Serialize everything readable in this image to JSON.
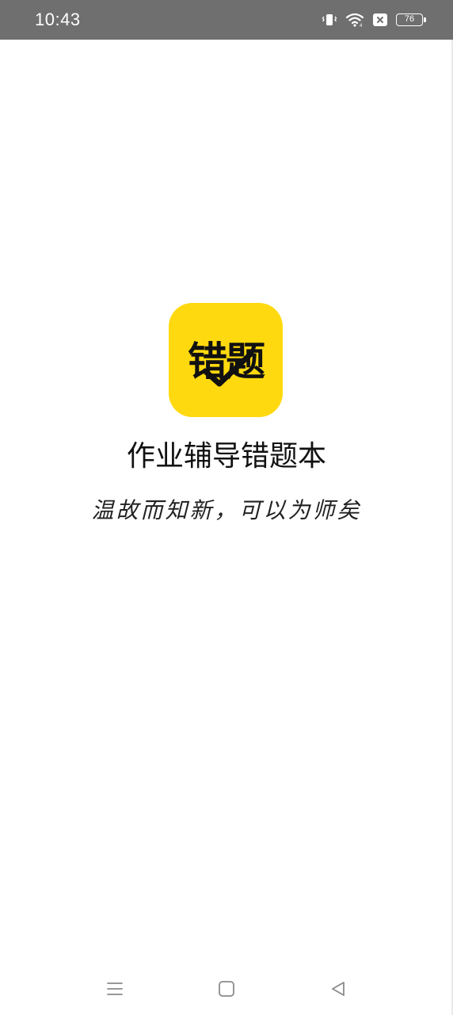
{
  "status_bar": {
    "time": "10:43",
    "battery_level": "76",
    "icons": [
      "vibrate-icon",
      "wifi-icon",
      "sim-off-icon",
      "battery-icon"
    ]
  },
  "splash": {
    "logo_text": "错题",
    "app_name": "作业辅导错题本",
    "slogan": "温故而知新，可以为师矣",
    "brand_color": "#ffd90f"
  },
  "nav_bar": {
    "icons": [
      "menu-icon",
      "home-icon",
      "back-icon"
    ]
  }
}
